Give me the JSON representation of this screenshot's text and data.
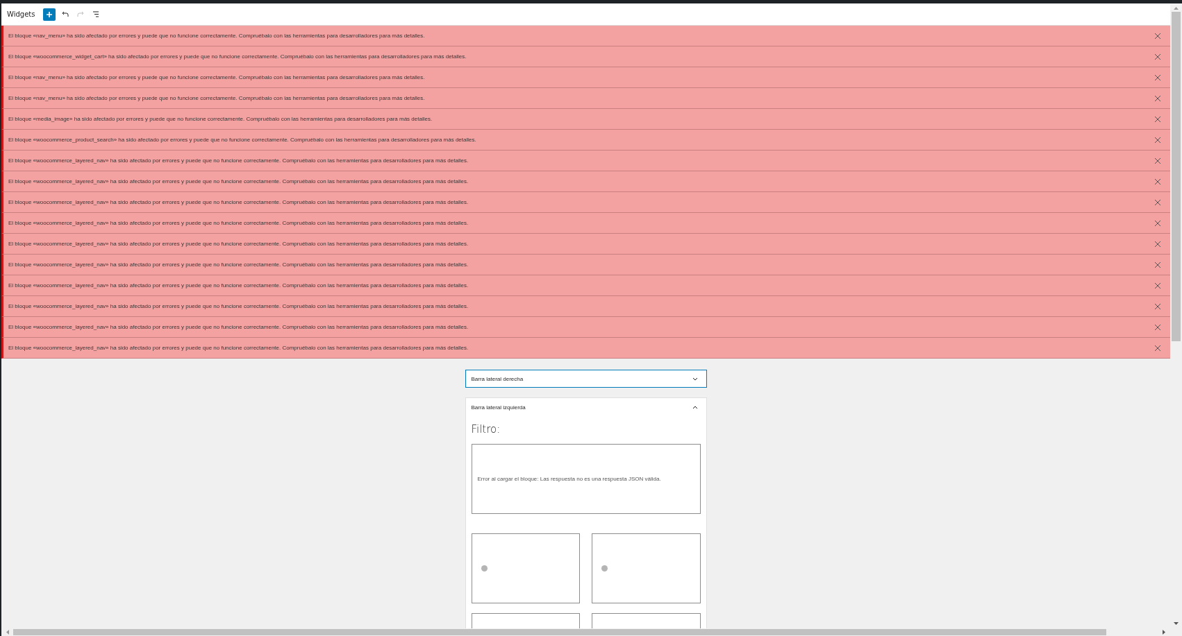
{
  "header": {
    "title": "Widgets"
  },
  "notices": [
    {
      "text": "El bloque «nav_menu» ha sido afectado por errores y puede que no funcione correctamente. Compruébalo con las herramientas para desarrolladores para más detalles."
    },
    {
      "text": "El bloque «woocommerce_widget_cart» ha sido afectado por errores y puede que no funcione correctamente. Compruébalo con las herramientas para desarrolladores para más detalles."
    },
    {
      "text": "El bloque «nav_menu» ha sido afectado por errores y puede que no funcione correctamente. Compruébalo con las herramientas para desarrolladores para más detalles."
    },
    {
      "text": "El bloque «nav_menu» ha sido afectado por errores y puede que no funcione correctamente. Compruébalo con las herramientas para desarrolladores para más detalles."
    },
    {
      "text": "El bloque «media_image» ha sido afectado por errores y puede que no funcione correctamente. Compruébalo con las herramientas para desarrolladores para más detalles."
    },
    {
      "text": "El bloque «woocommerce_product_search» ha sido afectado por errores y puede que no funcione correctamente. Compruébalo con las herramientas para desarrolladores para más detalles."
    },
    {
      "text": "El bloque «woocommerce_layered_nav» ha sido afectado por errores y puede que no funcione correctamente. Compruébalo con las herramientas para desarrolladores para más detalles."
    },
    {
      "text": "El bloque «woocommerce_layered_nav» ha sido afectado por errores y puede que no funcione correctamente. Compruébalo con las herramientas para desarrolladores para más detalles."
    },
    {
      "text": "El bloque «woocommerce_layered_nav» ha sido afectado por errores y puede que no funcione correctamente. Compruébalo con las herramientas para desarrolladores para más detalles."
    },
    {
      "text": "El bloque «woocommerce_layered_nav» ha sido afectado por errores y puede que no funcione correctamente. Compruébalo con las herramientas para desarrolladores para más detalles."
    },
    {
      "text": "El bloque «woocommerce_layered_nav» ha sido afectado por errores y puede que no funcione correctamente. Compruébalo con las herramientas para desarrolladores para más detalles."
    },
    {
      "text": "El bloque «woocommerce_layered_nav» ha sido afectado por errores y puede que no funcione correctamente. Compruébalo con las herramientas para desarrolladores para más detalles."
    },
    {
      "text": "El bloque «woocommerce_layered_nav» ha sido afectado por errores y puede que no funcione correctamente. Compruébalo con las herramientas para desarrolladores para más detalles."
    },
    {
      "text": "El bloque «woocommerce_layered_nav» ha sido afectado por errores y puede que no funcione correctamente. Compruébalo con las herramientas para desarrolladores para más detalles."
    },
    {
      "text": "El bloque «woocommerce_layered_nav» ha sido afectado por errores y puede que no funcione correctamente. Compruébalo con las herramientas para desarrolladores para más detalles."
    },
    {
      "text": "El bloque «woocommerce_layered_nav» ha sido afectado por errores y puede que no funcione correctamente. Compruébalo con las herramientas para desarrolladores para más detalles."
    }
  ],
  "areas": [
    {
      "title": "Barra lateral derecha",
      "expanded": false,
      "selected": true
    },
    {
      "title": "Barra lateral izquierda",
      "expanded": true,
      "selected": false,
      "heading": "Filtro:",
      "error": "Error al cargar el bloque: Las respuesta no es una respuesta JSON válida."
    }
  ]
}
